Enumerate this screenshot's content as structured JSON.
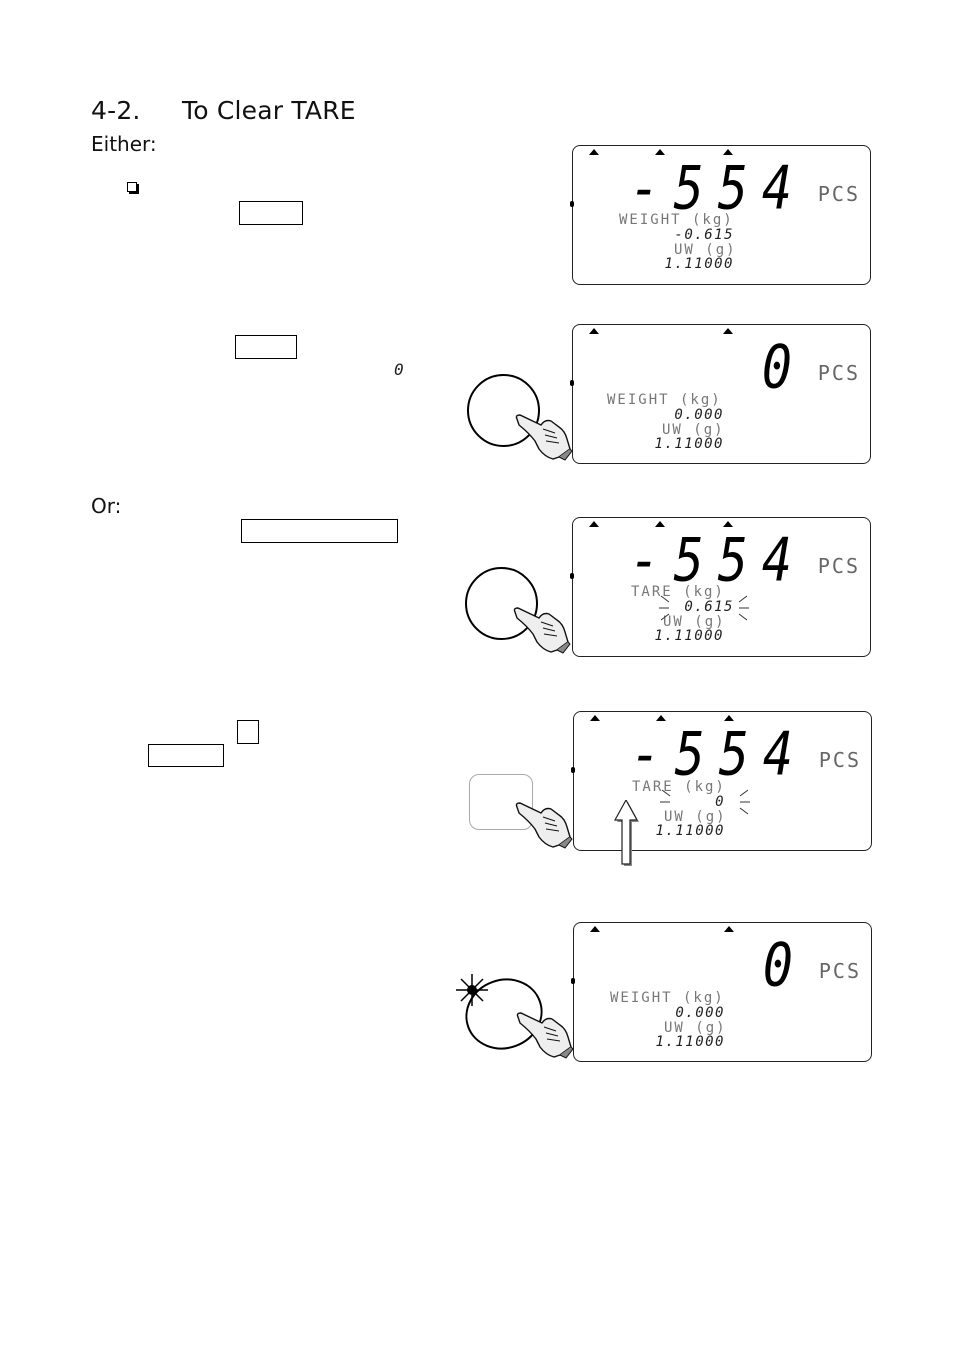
{
  "section": {
    "number": "4-2.",
    "title": "To Clear TARE"
  },
  "either_label": "Either:",
  "or_label": "Or:",
  "inline_display_value": "0",
  "lcd_unit": "PCS",
  "panels": [
    {
      "big_value": "-554",
      "line1_label": "WEIGHT (kg)",
      "line1_value": "-0.615",
      "line2_label": "UW (g)",
      "line2_value": "1.11000",
      "button": "none"
    },
    {
      "big_value": "0",
      "line1_label": "WEIGHT (kg)",
      "line1_value": "0.000",
      "line2_label": "UW (g)",
      "line2_value": "1.11000",
      "button": "circle-pressed"
    },
    {
      "big_value": "-554",
      "line1_label": "TARE (kg)",
      "line1_value": "0.615",
      "line2_label": "UW (g)",
      "line2_value": "1.11000",
      "button": "circle-pressed",
      "flashing": true
    },
    {
      "big_value": "-554",
      "line1_label": "TARE (kg)",
      "line1_value": "0",
      "line2_label": "UW (g)",
      "line2_value": "1.11000",
      "button": "square-pressed",
      "flashing": true,
      "arrow": "up-arrow"
    },
    {
      "big_value": "0",
      "line1_label": "WEIGHT (kg)",
      "line1_value": "0.000",
      "line2_label": "UW (g)",
      "line2_value": "1.11000",
      "button": "oval-pressed-lit"
    }
  ]
}
